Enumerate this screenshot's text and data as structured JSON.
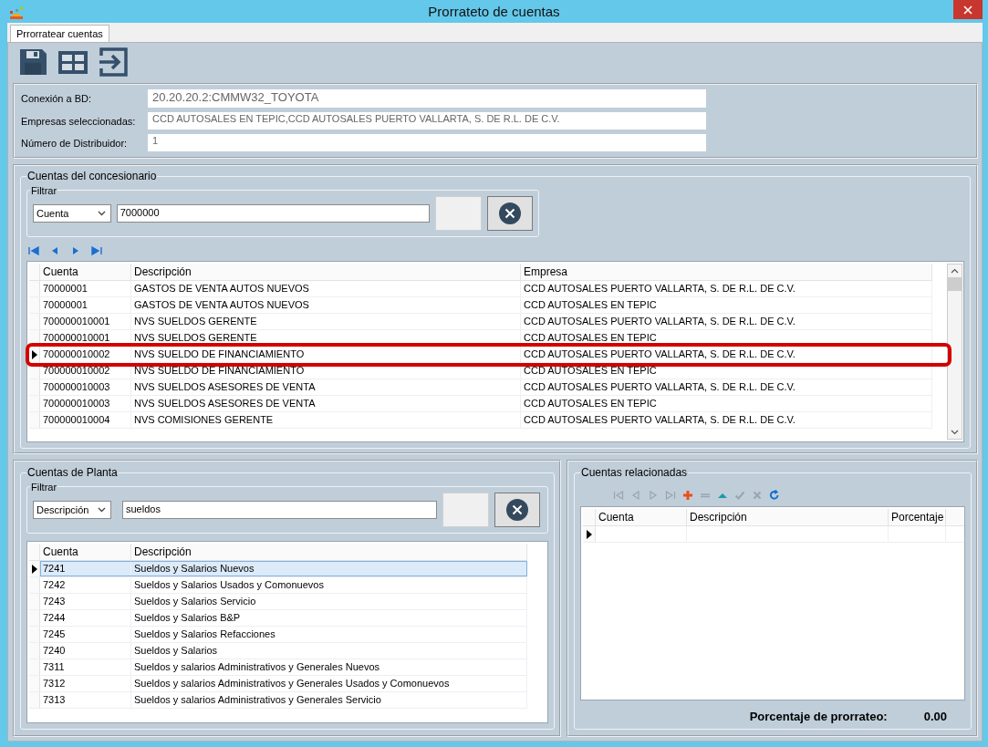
{
  "window": {
    "title": "Prorrateto de cuentas"
  },
  "tabs": [
    {
      "label": "Prrorratear cuentas",
      "selected": true
    }
  ],
  "toolbar": [
    {
      "kind": "save"
    },
    {
      "kind": "grid"
    },
    {
      "kind": "exit"
    }
  ],
  "connection_fields": [
    {
      "label": "Conexión a BD:",
      "value": "20.20.20.2:CMMW32_TOYOTA"
    },
    {
      "label": "Empresas seleccionadas:",
      "value": "CCD AUTOSALES EN TEPIC,CCD AUTOSALES PUERTO VALLARTA, S. DE R.L. DE C.V."
    },
    {
      "label": "Número de Distribuidor:",
      "value": "1"
    }
  ],
  "dealer_accounts": {
    "title": "Cuentas del concesionario",
    "filter": {
      "title": "Filtrar",
      "field": "Cuenta",
      "value": "7000000"
    },
    "navigator": [
      {
        "kind": "first",
        "disabled": false
      },
      {
        "kind": "prev",
        "disabled": false
      },
      {
        "kind": "next",
        "disabled": false
      },
      {
        "kind": "last",
        "disabled": false
      }
    ],
    "columns": [
      "Cuenta",
      "Descripción",
      "Empresa"
    ],
    "rows": [
      {
        "cells": [
          "70000001",
          "GASTOS DE VENTA AUTOS NUEVOS",
          "CCD AUTOSALES PUERTO VALLARTA, S. DE R.L. DE C.V."
        ],
        "selected": false,
        "annotated": false
      },
      {
        "cells": [
          "70000001",
          "GASTOS DE VENTA AUTOS NUEVOS",
          "CCD AUTOSALES EN TEPIC"
        ],
        "selected": false,
        "annotated": false
      },
      {
        "cells": [
          "700000010001",
          "NVS SUELDOS GERENTE",
          "CCD AUTOSALES PUERTO VALLARTA, S. DE R.L. DE C.V."
        ],
        "selected": false,
        "annotated": false
      },
      {
        "cells": [
          "700000010001",
          "NVS SUELDOS GERENTE",
          "CCD AUTOSALES EN TEPIC"
        ],
        "selected": false,
        "annotated": false
      },
      {
        "cells": [
          "700000010002",
          "NVS SUELDO DE FINANCIAMIENTO",
          "CCD AUTOSALES PUERTO VALLARTA, S. DE R.L. DE C.V."
        ],
        "selected": true,
        "annotated": true
      },
      {
        "cells": [
          "700000010002",
          "NVS SUELDO DE FINANCIAMIENTO",
          "CCD AUTOSALES EN TEPIC"
        ],
        "selected": false,
        "annotated": false
      },
      {
        "cells": [
          "700000010003",
          "NVS SUELDOS ASESORES DE VENTA",
          "CCD AUTOSALES PUERTO VALLARTA, S. DE R.L. DE C.V."
        ],
        "selected": false,
        "annotated": false
      },
      {
        "cells": [
          "700000010003",
          "NVS SUELDOS ASESORES DE VENTA",
          "CCD AUTOSALES EN TEPIC"
        ],
        "selected": false,
        "annotated": false
      },
      {
        "cells": [
          "700000010004",
          "NVS COMISIONES GERENTE",
          "CCD AUTOSALES PUERTO VALLARTA, S. DE R.L. DE C.V."
        ],
        "selected": false,
        "annotated": false
      }
    ]
  },
  "plant_accounts": {
    "title": "Cuentas de Planta",
    "filter": {
      "title": "Filtrar",
      "field": "Descripción",
      "value": "sueldos"
    },
    "columns": [
      "Cuenta",
      "Descripción"
    ],
    "rows": [
      {
        "cells": [
          "7241",
          "Sueldos y Salarios  Nuevos"
        ],
        "selected": true
      },
      {
        "cells": [
          "7242",
          "Sueldos y Salarios  Usados y Comonuevos"
        ],
        "selected": false
      },
      {
        "cells": [
          "7243",
          "Sueldos y Salarios  Servicio"
        ],
        "selected": false
      },
      {
        "cells": [
          "7244",
          "Sueldos y Salarios  B&P"
        ],
        "selected": false
      },
      {
        "cells": [
          "7245",
          "Sueldos y Salarios  Refacciones"
        ],
        "selected": false
      },
      {
        "cells": [
          "7240",
          "Sueldos y Salarios"
        ],
        "selected": false
      },
      {
        "cells": [
          "7311",
          "Sueldos y salarios Administrativos y Generales  Nuevos"
        ],
        "selected": false
      },
      {
        "cells": [
          "7312",
          "Sueldos y salarios Administrativos y Generales  Usados y Comonuevos"
        ],
        "selected": false
      },
      {
        "cells": [
          "7313",
          "Sueldos y salarios Administrativos y Generales  Servicio"
        ],
        "selected": false
      }
    ]
  },
  "related_accounts": {
    "title": "Cuentas relacionadas",
    "navigator": [
      {
        "kind": "first",
        "disabled": true
      },
      {
        "kind": "prev",
        "disabled": true
      },
      {
        "kind": "next",
        "disabled": true
      },
      {
        "kind": "last",
        "disabled": true
      },
      {
        "kind": "add",
        "disabled": false
      },
      {
        "kind": "delete",
        "disabled": true
      },
      {
        "kind": "edit",
        "disabled": false
      },
      {
        "kind": "post",
        "disabled": true
      },
      {
        "kind": "cancel",
        "disabled": true
      },
      {
        "kind": "refresh",
        "disabled": false
      }
    ],
    "columns": [
      "Cuenta",
      "Descripción",
      "Porcentaje"
    ],
    "rows": [
      {
        "selected": true
      }
    ],
    "total_label": "Porcentaje de prorrateo:",
    "total_value": "0.00"
  }
}
